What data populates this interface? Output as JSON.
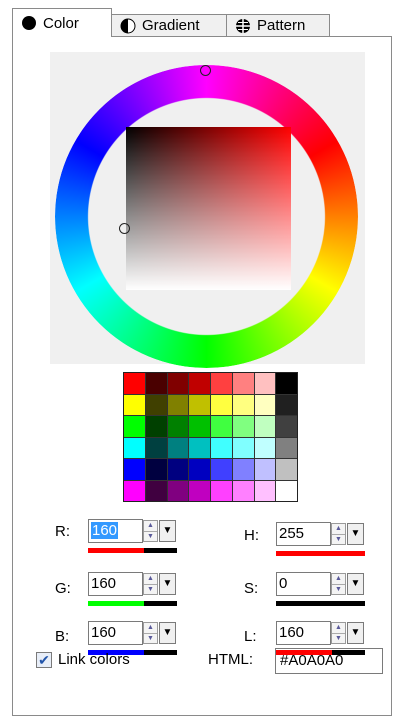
{
  "tabs": [
    {
      "label": "Color",
      "icon": "filled-circle-icon"
    },
    {
      "label": "Gradient",
      "icon": "half-circle-icon"
    },
    {
      "label": "Pattern",
      "icon": "pattern-globe-icon"
    }
  ],
  "palette": {
    "colors": [
      [
        "#ff0000",
        "#4a0000",
        "#800000",
        "#c00000",
        "#ff4040",
        "#ff8080",
        "#ffc0c0",
        "#000000"
      ],
      [
        "#ffff00",
        "#404000",
        "#808000",
        "#c0c000",
        "#ffff40",
        "#ffff80",
        "#ffffc0",
        "#202020"
      ],
      [
        "#00ff00",
        "#004000",
        "#008000",
        "#00c000",
        "#40ff40",
        "#80ff80",
        "#c0ffc0",
        "#404040"
      ],
      [
        "#00ffff",
        "#004040",
        "#008080",
        "#00c0c0",
        "#40ffff",
        "#80ffff",
        "#c0ffff",
        "#808080"
      ],
      [
        "#0000ff",
        "#000040",
        "#000080",
        "#0000c0",
        "#4040ff",
        "#8080ff",
        "#c0c0ff",
        "#c0c0c0"
      ],
      [
        "#ff00ff",
        "#400040",
        "#800080",
        "#c000c0",
        "#ff40ff",
        "#ff80ff",
        "#ffc0ff",
        "#ffffff"
      ]
    ]
  },
  "fields": {
    "r": {
      "label": "R:",
      "value": "160",
      "fill": 0.627,
      "color": "#ff0000"
    },
    "g": {
      "label": "G:",
      "value": "160",
      "fill": 0.627,
      "color": "#00ff00"
    },
    "b": {
      "label": "B:",
      "value": "160",
      "fill": 0.627,
      "color": "#0000ff"
    },
    "h": {
      "label": "H:",
      "value": "255",
      "fill": 1.0,
      "color": "#ff0000"
    },
    "s": {
      "label": "S:",
      "value": "0",
      "fill": 0.0,
      "color": "#ff0000"
    },
    "l": {
      "label": "L:",
      "value": "160",
      "fill": 0.627,
      "color": "#ff0000"
    }
  },
  "link_colors": {
    "label": "Link colors",
    "checked": true
  },
  "html": {
    "label": "HTML:",
    "value": "#A0A0A0"
  },
  "colors": {
    "tab_bg": "#f0f0f0",
    "wheel_bg": "#f0f0f0",
    "selection": "#3399ff"
  }
}
